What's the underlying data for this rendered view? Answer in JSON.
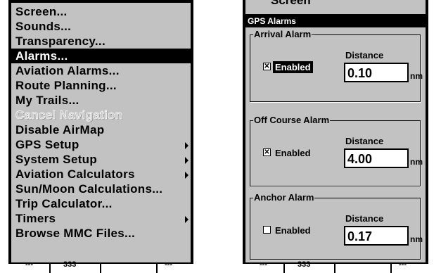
{
  "menu": {
    "items": [
      {
        "label": "Screen...",
        "submenu": false,
        "selected": false,
        "disabled": false
      },
      {
        "label": "Sounds...",
        "submenu": false,
        "selected": false,
        "disabled": false
      },
      {
        "label": "Transparency...",
        "submenu": false,
        "selected": false,
        "disabled": false
      },
      {
        "label": "Alarms...",
        "submenu": false,
        "selected": true,
        "disabled": false
      },
      {
        "label": "Aviation Alarms...",
        "submenu": false,
        "selected": false,
        "disabled": false
      },
      {
        "label": "Route Planning...",
        "submenu": false,
        "selected": false,
        "disabled": false
      },
      {
        "label": "My Trails...",
        "submenu": false,
        "selected": false,
        "disabled": false
      },
      {
        "label": "Cancel Navigation",
        "submenu": false,
        "selected": false,
        "disabled": true
      },
      {
        "label": "Disable AirMap",
        "submenu": false,
        "selected": false,
        "disabled": false
      },
      {
        "label": "GPS Setup",
        "submenu": true,
        "selected": false,
        "disabled": false
      },
      {
        "label": "System Setup",
        "submenu": true,
        "selected": false,
        "disabled": false
      },
      {
        "label": "Aviation Calculators",
        "submenu": true,
        "selected": false,
        "disabled": false
      },
      {
        "label": "Sun/Moon Calculations...",
        "submenu": false,
        "selected": false,
        "disabled": false
      },
      {
        "label": "Trip Calculator...",
        "submenu": false,
        "selected": false,
        "disabled": false
      },
      {
        "label": "Timers",
        "submenu": true,
        "selected": false,
        "disabled": false
      },
      {
        "label": "Browse MMC Files...",
        "submenu": false,
        "selected": false,
        "disabled": false
      }
    ],
    "bottom_fragments": [
      "---",
      "333",
      "---"
    ]
  },
  "dialog": {
    "behind_text": "Screen",
    "title": "GPS Alarms",
    "bottom_fragments": [
      "---",
      "333",
      "---"
    ],
    "groups": [
      {
        "title": "Arrival Alarm",
        "enabled_label": "Enabled",
        "checked": true,
        "check_mark": "✕",
        "focused": true,
        "distance_label": "Distance",
        "distance": "0.10",
        "unit": "nm"
      },
      {
        "title": "Off Course Alarm",
        "enabled_label": "Enabled",
        "checked": true,
        "check_mark": "✕",
        "focused": false,
        "distance_label": "Distance",
        "distance": "4.00",
        "unit": "nm"
      },
      {
        "title": "Anchor Alarm",
        "enabled_label": "Enabled",
        "checked": false,
        "check_mark": "",
        "focused": false,
        "distance_label": "Distance",
        "distance": "0.17",
        "unit": "nm"
      }
    ]
  }
}
